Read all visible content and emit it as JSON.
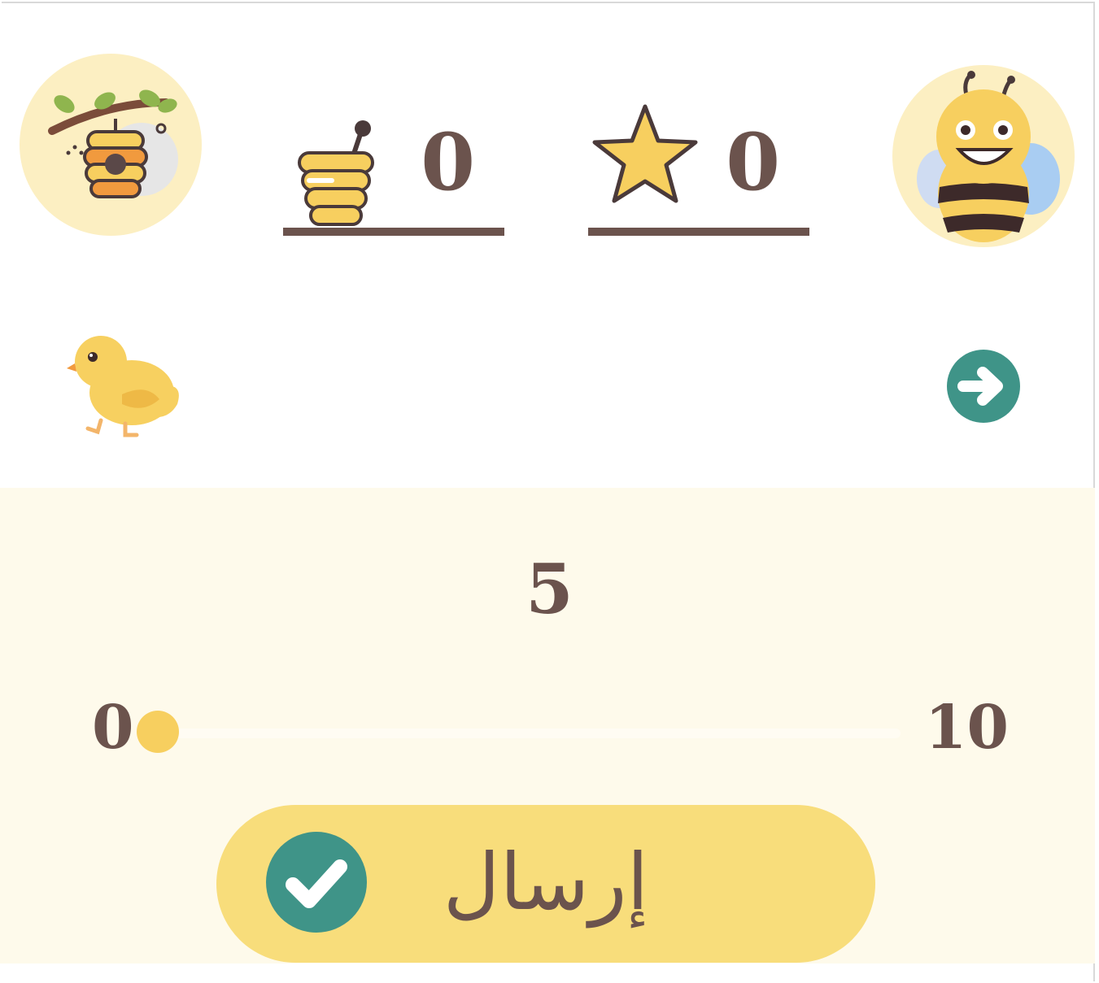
{
  "header": {
    "left_avatar_icon": "beehive-icon",
    "right_avatar_icon": "bee-mascot-icon",
    "honey_counter": {
      "icon": "honey-jar-icon",
      "value": "0"
    },
    "star_counter": {
      "icon": "star-icon",
      "value": "0"
    }
  },
  "toolbar": {
    "mascot_icon": "chick-icon",
    "next_icon": "arrow-right-circle-icon"
  },
  "question": {
    "number": "5"
  },
  "slider": {
    "min_label": "0",
    "max_label": "10",
    "value": 0,
    "min": 0,
    "max": 10
  },
  "submit": {
    "label": "إرسال",
    "icon": "check-circle-icon"
  },
  "colors": {
    "text": "#6b534d",
    "avatar_bg": "#fcefc2",
    "panel_bg": "#fefaeb",
    "button_bg": "#f8dd7b",
    "accent_teal": "#3f9488",
    "thumb": "#f7cf5f"
  }
}
